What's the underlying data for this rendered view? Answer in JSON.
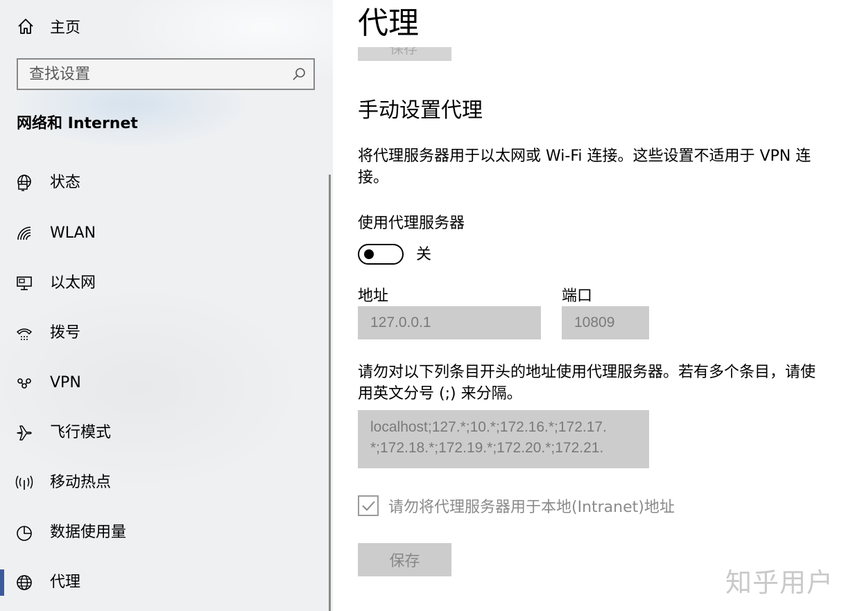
{
  "sidebar": {
    "home_label": "主页",
    "search_placeholder": "查找设置",
    "section_title": "网络和 Internet",
    "items": [
      {
        "label": "状态",
        "icon": "globe-monitor-icon"
      },
      {
        "label": "WLAN",
        "icon": "wifi-icon"
      },
      {
        "label": "以太网",
        "icon": "ethernet-icon"
      },
      {
        "label": "拨号",
        "icon": "dialup-icon"
      },
      {
        "label": "VPN",
        "icon": "vpn-icon"
      },
      {
        "label": "飞行模式",
        "icon": "airplane-icon"
      },
      {
        "label": "移动热点",
        "icon": "hotspot-icon"
      },
      {
        "label": "数据使用量",
        "icon": "data-usage-icon"
      },
      {
        "label": "代理",
        "icon": "globe-icon",
        "active": true
      }
    ]
  },
  "main": {
    "page_title": "代理",
    "top_button_label": "保存",
    "manual_title": "手动设置代理",
    "manual_desc": "将代理服务器用于以太网或 Wi-Fi 连接。这些设置不适用于 VPN 连接。",
    "use_proxy_label": "使用代理服务器",
    "toggle_state": "关",
    "address_label": "地址",
    "address_value": "127.0.0.1",
    "port_label": "端口",
    "port_value": "10809",
    "exceptions_desc": "请勿对以下列条目开头的地址使用代理服务器。若有多个条目，请使用英文分号 (;) 来分隔。",
    "exceptions_value": "localhost;127.*;10.*;172.16.*;172.17.\n*;172.18.*;172.19.*;172.20.*;172.21.",
    "bypass_local_label": "请勿将代理服务器用于本地(Intranet)地址",
    "bypass_local_checked": true,
    "save_label": "保存"
  },
  "watermark": "知乎用户",
  "colors": {
    "sidebar_bg": "#eef0f2",
    "field_bg": "#cccccc",
    "active_indicator": "#3a5a9a"
  }
}
